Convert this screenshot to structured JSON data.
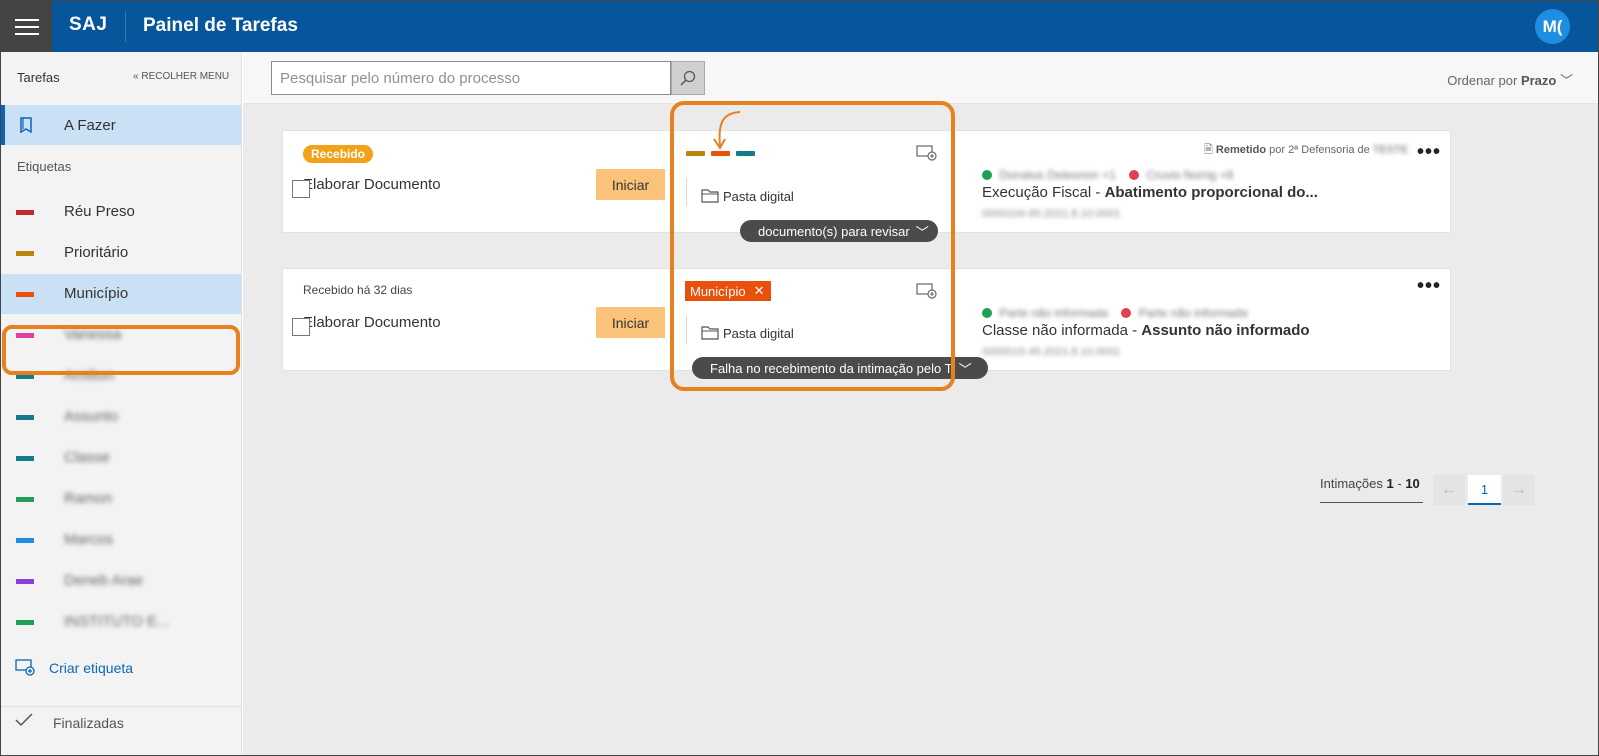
{
  "header": {
    "brand": "SAJ",
    "title": "Painel de Tarefas",
    "avatar_initials": "M("
  },
  "sidebar": {
    "section_title": "Tarefas",
    "collapse_label": "RECOLHER MENU",
    "active_item": "A Fazer",
    "labels_title": "Etiquetas",
    "tags": [
      {
        "label": "Réu Preso",
        "color": "#c0282d"
      },
      {
        "label": "Prioritário",
        "color": "#b8860b"
      },
      {
        "label": "Município",
        "color": "#e8500c",
        "selected": true
      },
      {
        "label": "Vanessa",
        "color": "#e040a0"
      },
      {
        "label": "Amilton",
        "color": "#157a8a"
      },
      {
        "label": "Assunto",
        "color": "#157a8a"
      },
      {
        "label": "Classe",
        "color": "#157a8a"
      },
      {
        "label": "Ramon",
        "color": "#1fa055"
      },
      {
        "label": "Marcos",
        "color": "#1e8fe0"
      },
      {
        "label": "Deneb Arae",
        "color": "#8a3ee0"
      },
      {
        "label": "INSTITUTO E...",
        "color": "#1fa055"
      }
    ],
    "create_label": "Criar etiqueta",
    "finished_label": "Finalizadas"
  },
  "toolbar": {
    "search_placeholder": "Pesquisar pelo número do processo",
    "order_prefix": "Ordenar por",
    "order_value": "Prazo"
  },
  "cards": [
    {
      "status_badge": "Recebido",
      "title": "Elaborar Documento",
      "start_label": "Iniciar",
      "tag_colors": [
        "#b8860b",
        "#e8500c",
        "#157a8a"
      ],
      "folder_label": "Pasta digital",
      "pill_label": "documento(s) para revisar",
      "remetido_label": "Remetido",
      "remetido_by": "por 2ª Defensoria de",
      "remetido_place": "TESTE",
      "party_a": "Donatus Deleonon +1",
      "party_b": "Cruvis Norrig +8",
      "case_class": "Execução Fiscal",
      "case_subject": "Abatimento proporcional do...",
      "process_number": "0000104-95.2021.8.10.0001"
    },
    {
      "received_text": "Recebido há 32 dias",
      "title": "Elaborar Documento",
      "start_label": "Iniciar",
      "tag_label": "Município",
      "tag_color": "#e8500c",
      "folder_label": "Pasta digital",
      "pill_label": "Falha no recebimento da intimação pelo T",
      "party_a": "Parte não informada",
      "party_b": "Parte não informada",
      "case_class": "Classe não informada",
      "case_subject": "Assunto não informado",
      "process_number": "0000015-45.2021.8.10.0001"
    }
  ],
  "pagination": {
    "label": "Intimações",
    "range_start": "1",
    "range_sep": "-",
    "range_end": "10",
    "current_page": "1"
  },
  "colors": {
    "header_blue": "#07559a",
    "highlight_orange": "#e7801e",
    "active_blue": "#0b66b8"
  }
}
